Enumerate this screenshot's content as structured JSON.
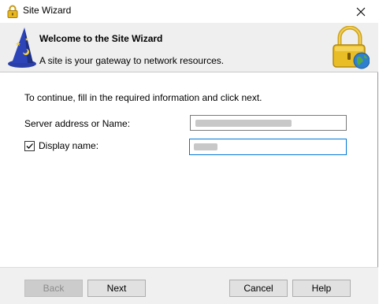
{
  "window": {
    "title": "Site Wizard",
    "icon": "lock-icon",
    "close": "close-icon"
  },
  "banner": {
    "title": "Welcome to the Site Wizard",
    "subtitle": "A site is your gateway to network resources.",
    "left_icon": "wizard-hat-icon",
    "right_icon": "padlock-globe-icon"
  },
  "form": {
    "instruction": "To continue, fill in the required information and click next.",
    "server_label": "Server address or Name:",
    "server_value": "",
    "display_checked": true,
    "display_label": "Display name:",
    "display_value": ""
  },
  "buttons": {
    "back": "Back",
    "next": "Next",
    "cancel": "Cancel",
    "help": "Help"
  },
  "colors": {
    "focus_border": "#0078d7",
    "banner_bg": "#efefef",
    "footer_bg": "#f0f0f0"
  }
}
